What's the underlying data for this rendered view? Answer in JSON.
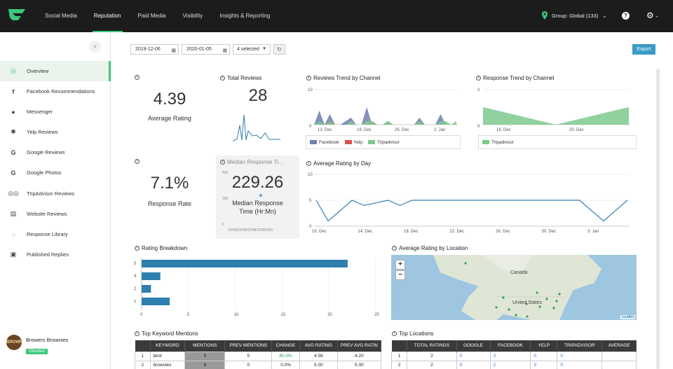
{
  "topnav": {
    "items": [
      "Social Media",
      "Reputation",
      "Paid Media",
      "Visibility",
      "Insights & Reporting"
    ],
    "active": "Reputation",
    "group": "Group: Global (133)"
  },
  "sidebar": {
    "items": [
      {
        "label": "Overview",
        "icon": "overview-icon"
      },
      {
        "label": "Facebook Recommendations",
        "icon": "facebook-icon"
      },
      {
        "label": "Messenger",
        "icon": "messenger-icon"
      },
      {
        "label": "Yelp Reviews",
        "icon": "yelp-icon"
      },
      {
        "label": "Google Reviews",
        "icon": "google-icon"
      },
      {
        "label": "Google Photos",
        "icon": "google-icon"
      },
      {
        "label": "TripAdvisor Reviews",
        "icon": "tripadvisor-icon"
      },
      {
        "label": "Website Reviews",
        "icon": "website-icon"
      },
      {
        "label": "Response Library",
        "icon": "library-icon"
      },
      {
        "label": "Published Replies",
        "icon": "replies-icon"
      }
    ],
    "user": {
      "name": "Browers Brownies",
      "badge": "Ghosted",
      "avatar_text": "BROWN"
    }
  },
  "toolbar": {
    "start_date": "2019-12-06",
    "end_date": "2020-01-05",
    "select": "4 selected",
    "export": "Export"
  },
  "kpis": {
    "avg_rating": {
      "value": "4.39",
      "label": "Average Rating"
    },
    "total_reviews": {
      "title": "Total Reviews",
      "value": "28"
    },
    "response_rate": {
      "value": "7.1%",
      "label": "Response Rate"
    },
    "median": {
      "title": "Median Response Ti...",
      "value": "229.26",
      "label1": "Median Response",
      "label2": "Time (Hr:Mn)",
      "y_top": "400",
      "y_mid": "200",
      "y_bottom": "0",
      "x_ticks": "22/08/22/08/22/08/22/08/200"
    }
  },
  "reviews_trend": {
    "title": "Reviews Trend by Channel",
    "y_max": "10",
    "y_min": "0",
    "x_ticks": [
      "12. Dec",
      "19. Dec",
      "26. Dec",
      "2. Jan"
    ],
    "legend": [
      "Facebook",
      "Yelp",
      "Tripadvisor"
    ]
  },
  "response_trend": {
    "title": "Response Trend by Channel",
    "y_max": "2",
    "y_min": "0",
    "x_ticks": [
      "16. Dec",
      "23. Dec"
    ],
    "legend": [
      "Tripadvisor"
    ]
  },
  "avg_rating_day": {
    "title": "Average Rating by Day",
    "y_ticks": [
      "10",
      "5",
      "0"
    ],
    "x_ticks": [
      "10. Dec",
      "14. Dec",
      "18. Dec",
      "22. Dec",
      "26. Dec",
      "30. Dec",
      "3. Jan"
    ]
  },
  "rating_breakdown": {
    "title": "Rating Breakdown"
  },
  "location_map": {
    "title": "Average Rating by Location",
    "canada": "Canada",
    "us": "United States",
    "attribution": "Leaflet",
    "zoom_in": "+",
    "zoom_out": "−"
  },
  "keywords": {
    "title": "Top Keyword Mentions",
    "headers": [
      "",
      "KEYWORD",
      "MENTIONS",
      "PREV MENTIONS",
      "CHANGE",
      "AVG RATING",
      "PREV AVG RATIN"
    ],
    "rows": [
      [
        "1",
        "best",
        "9",
        "5",
        "80.0%",
        "4.56",
        "4.20"
      ],
      [
        "2",
        "brownies",
        "9",
        "0",
        "0.0%",
        "5.00",
        "5.00"
      ]
    ]
  },
  "locations": {
    "title": "Top Locations",
    "headers": [
      "",
      "TOTAL RATINGS",
      "GOOGLE",
      "FACEBOOK",
      "YELP",
      "TRIPADVISOR",
      "AVERAGE"
    ],
    "rows": [
      [
        "1",
        "2",
        "0",
        "2",
        "0",
        "0",
        ""
      ],
      [
        "2",
        "2",
        "0",
        "2",
        "0",
        "0",
        ""
      ]
    ]
  },
  "chart_data": [
    {
      "type": "area",
      "title": "Reviews Trend by Channel",
      "x": [
        "Dec 9",
        "Dec 10",
        "Dec 11",
        "Dec 12",
        "Dec 13",
        "Dec 14",
        "Dec 15",
        "Dec 16",
        "Dec 17",
        "Dec 18",
        "Dec 19",
        "Dec 20",
        "Dec 21",
        "Dec 22",
        "Dec 23",
        "Dec 24",
        "Dec 25",
        "Dec 26",
        "Dec 27",
        "Dec 28",
        "Dec 29",
        "Dec 30",
        "Dec 31",
        "Jan 1",
        "Jan 2",
        "Jan 3",
        "Jan 4",
        "Jan 5"
      ],
      "series": [
        {
          "name": "Facebook",
          "color": "#6f7fae",
          "values": [
            0,
            4,
            0,
            3,
            0,
            0,
            1,
            2,
            0,
            0,
            5,
            0,
            0,
            0,
            1,
            0,
            0,
            0,
            0,
            0,
            2,
            0,
            0,
            0,
            3,
            0,
            0,
            0
          ]
        },
        {
          "name": "Yelp",
          "color": "#d9534f",
          "values": [
            0,
            0,
            0,
            1,
            0,
            0,
            0,
            0,
            0,
            0,
            0,
            1,
            0,
            0,
            0,
            0,
            0,
            0,
            0,
            0,
            0,
            0,
            0,
            0,
            0,
            0,
            0,
            0
          ]
        },
        {
          "name": "Tripadvisor",
          "color": "#7cc98e",
          "values": [
            0,
            1,
            0,
            1,
            0,
            0,
            0,
            1,
            0,
            0,
            1,
            1,
            0,
            0,
            1,
            0,
            0,
            0,
            0,
            0,
            1,
            0,
            0,
            0,
            1,
            1,
            0,
            1
          ]
        }
      ],
      "ylim": [
        0,
        10
      ]
    },
    {
      "type": "area",
      "title": "Response Trend by Channel",
      "x": [
        "Dec 9",
        "Dec 23",
        "Jan 5"
      ],
      "series": [
        {
          "name": "Tripadvisor",
          "color": "#7cc98e",
          "values": [
            1,
            0,
            1
          ]
        }
      ],
      "ylim": [
        0,
        2
      ]
    },
    {
      "type": "line",
      "title": "Average Rating by Day",
      "x": [
        "Dec 10",
        "Dec 11",
        "Dec 12",
        "Dec 13",
        "Dec 14",
        "Dec 15",
        "Dec 16",
        "Dec 17",
        "Dec 18",
        "Dec 19",
        "Dec 20",
        "Dec 21",
        "Dec 22",
        "Dec 23",
        "Dec 24",
        "Dec 25",
        "Dec 26",
        "Dec 27",
        "Dec 28",
        "Dec 29",
        "Dec 30",
        "Dec 31",
        "Jan 1",
        "Jan 2",
        "Jan 3",
        "Jan 4",
        "Jan 5"
      ],
      "values": [
        5,
        1,
        3,
        5,
        4,
        4.5,
        5,
        4,
        5,
        5,
        5,
        5,
        5,
        5,
        5,
        5,
        5,
        5,
        5,
        5,
        5,
        5,
        5,
        3,
        1,
        3,
        5
      ],
      "ylim": [
        0,
        10
      ]
    },
    {
      "type": "bar",
      "title": "Rating Breakdown",
      "categories": [
        "5",
        "4",
        "2",
        "1"
      ],
      "values": [
        22,
        2,
        1,
        3
      ],
      "xlim": [
        0,
        25
      ],
      "x_ticks": [
        "0",
        "5",
        "10",
        "15",
        "20",
        "25"
      ]
    }
  ],
  "colors": {
    "accent": "#3cc77a",
    "bar": "#2f7fae",
    "line": "#2f7fae"
  }
}
